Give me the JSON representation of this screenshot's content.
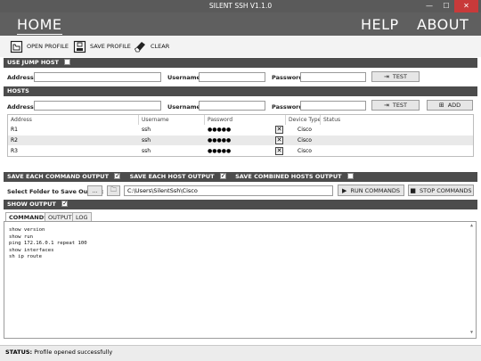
{
  "window": {
    "title": "SILENT SSH V1.1.0",
    "min_glyph": "—",
    "max_glyph": "☐",
    "close_glyph": "✕"
  },
  "nav": {
    "home": "HOME",
    "help": "HELP",
    "about": "ABOUT"
  },
  "toolbar": {
    "open": "OPEN PROFILE",
    "save": "SAVE PROFILE",
    "clear": "CLEAR"
  },
  "jump_host": {
    "header": "USE JUMP HOST",
    "checked": false,
    "address_label": "Address:",
    "username_label": "Username:",
    "password_label": "Password:",
    "test_label": "TEST"
  },
  "hosts": {
    "header": "HOSTS",
    "address_label": "Address:",
    "username_label": "Username:",
    "password_label": "Password:",
    "test_label": "TEST",
    "add_label": "ADD",
    "columns": [
      "Address",
      "Username",
      "Password",
      "Device Type",
      "Status"
    ],
    "rows": [
      {
        "address": "R1",
        "username": "ssh",
        "password": "●●●●●",
        "device_type": "Cisco",
        "status": ""
      },
      {
        "address": "R2",
        "username": "ssh",
        "password": "●●●●●",
        "device_type": "Cisco",
        "status": ""
      },
      {
        "address": "R3",
        "username": "ssh",
        "password": "●●●●●",
        "device_type": "Cisco",
        "status": ""
      }
    ]
  },
  "options": {
    "save_each_command": "SAVE EACH COMMAND OUTPUT",
    "save_each_command_checked": true,
    "save_each_host": "SAVE EACH HOST OUTPUT",
    "save_each_host_checked": true,
    "save_combined": "SAVE COMBINED HOSTS OUTPUT",
    "save_combined_checked": false
  },
  "output_folder": {
    "label": "Select Folder to Save Output:",
    "browse_label": "...",
    "path": "C:\\Users\\SilentSsh\\Cisco",
    "run_label": "RUN COMMANDS",
    "stop_label": "STOP COMMANDS"
  },
  "show_output": {
    "header": "SHOW OUTPUT",
    "checked": true
  },
  "tabs": [
    "COMMANDS",
    "OUTPUT",
    "LOG"
  ],
  "commands": [
    "show version",
    "show run",
    "ping 172.16.0.1 repeat 100",
    "show interfaces",
    "sh ip route"
  ],
  "status": {
    "label": "STATUS:",
    "text": "Profile opened successfully"
  }
}
